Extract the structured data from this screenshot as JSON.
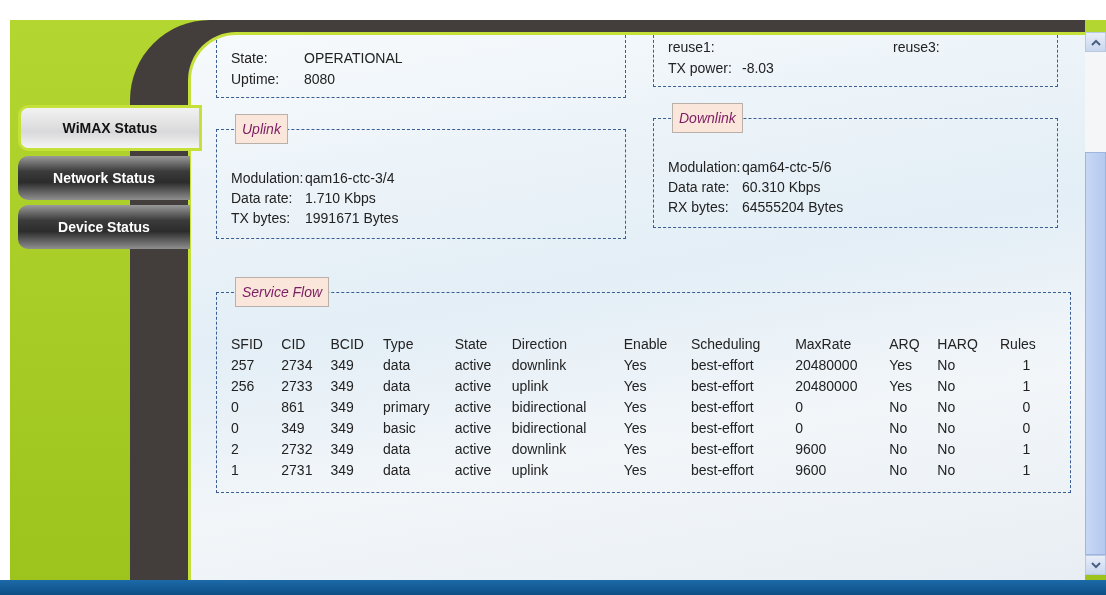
{
  "sidebar": {
    "items": [
      {
        "label": "WiMAX Status",
        "selected": true
      },
      {
        "label": "Network Status",
        "selected": false
      },
      {
        "label": "Device Status",
        "selected": false
      }
    ]
  },
  "status_left": {
    "rows": [
      {
        "label": "State:",
        "value": "OPERATIONAL"
      },
      {
        "label": "Uptime:",
        "value": "8080"
      }
    ]
  },
  "status_right": {
    "reuse_labels": [
      "reuse1:",
      "reuse3:"
    ],
    "rows": [
      {
        "label": "TX power:",
        "value": "-8.03"
      }
    ]
  },
  "uplink": {
    "legend": "Uplink",
    "rows": [
      {
        "label": "Modulation:",
        "value": "qam16-ctc-3/4"
      },
      {
        "label": "Data rate:",
        "value": "1.710 Kbps"
      },
      {
        "label": "TX bytes:",
        "value": "1991671 Bytes"
      }
    ]
  },
  "downlink": {
    "legend": "Downlink",
    "rows": [
      {
        "label": "Modulation:",
        "value": "qam64-ctc-5/6"
      },
      {
        "label": "Data rate:",
        "value": "60.310 Kbps"
      },
      {
        "label": "RX bytes:",
        "value": "64555204 Bytes"
      }
    ]
  },
  "service_flow": {
    "legend": "Service Flow",
    "columns": [
      "SFID",
      "CID",
      "BCID",
      "Type",
      "State",
      "Direction",
      "Enable",
      "Scheduling",
      "MaxRate",
      "ARQ",
      "HARQ",
      "Rules"
    ],
    "rows": [
      [
        "257",
        "2734",
        "349",
        "data",
        "active",
        "downlink",
        "Yes",
        "best-effort",
        "20480000",
        "Yes",
        "No",
        "1"
      ],
      [
        "256",
        "2733",
        "349",
        "data",
        "active",
        "uplink",
        "Yes",
        "best-effort",
        "20480000",
        "Yes",
        "No",
        "1"
      ],
      [
        "0",
        "861",
        "349",
        "primary",
        "active",
        "bidirectional",
        "Yes",
        "best-effort",
        "0",
        "No",
        "No",
        "0"
      ],
      [
        "0",
        "349",
        "349",
        "basic",
        "active",
        "bidirectional",
        "Yes",
        "best-effort",
        "0",
        "No",
        "No",
        "0"
      ],
      [
        "2",
        "2732",
        "349",
        "data",
        "active",
        "downlink",
        "Yes",
        "best-effort",
        "9600",
        "No",
        "No",
        "1"
      ],
      [
        "1",
        "2731",
        "349",
        "data",
        "active",
        "uplink",
        "Yes",
        "best-effort",
        "9600",
        "No",
        "No",
        "1"
      ]
    ]
  }
}
